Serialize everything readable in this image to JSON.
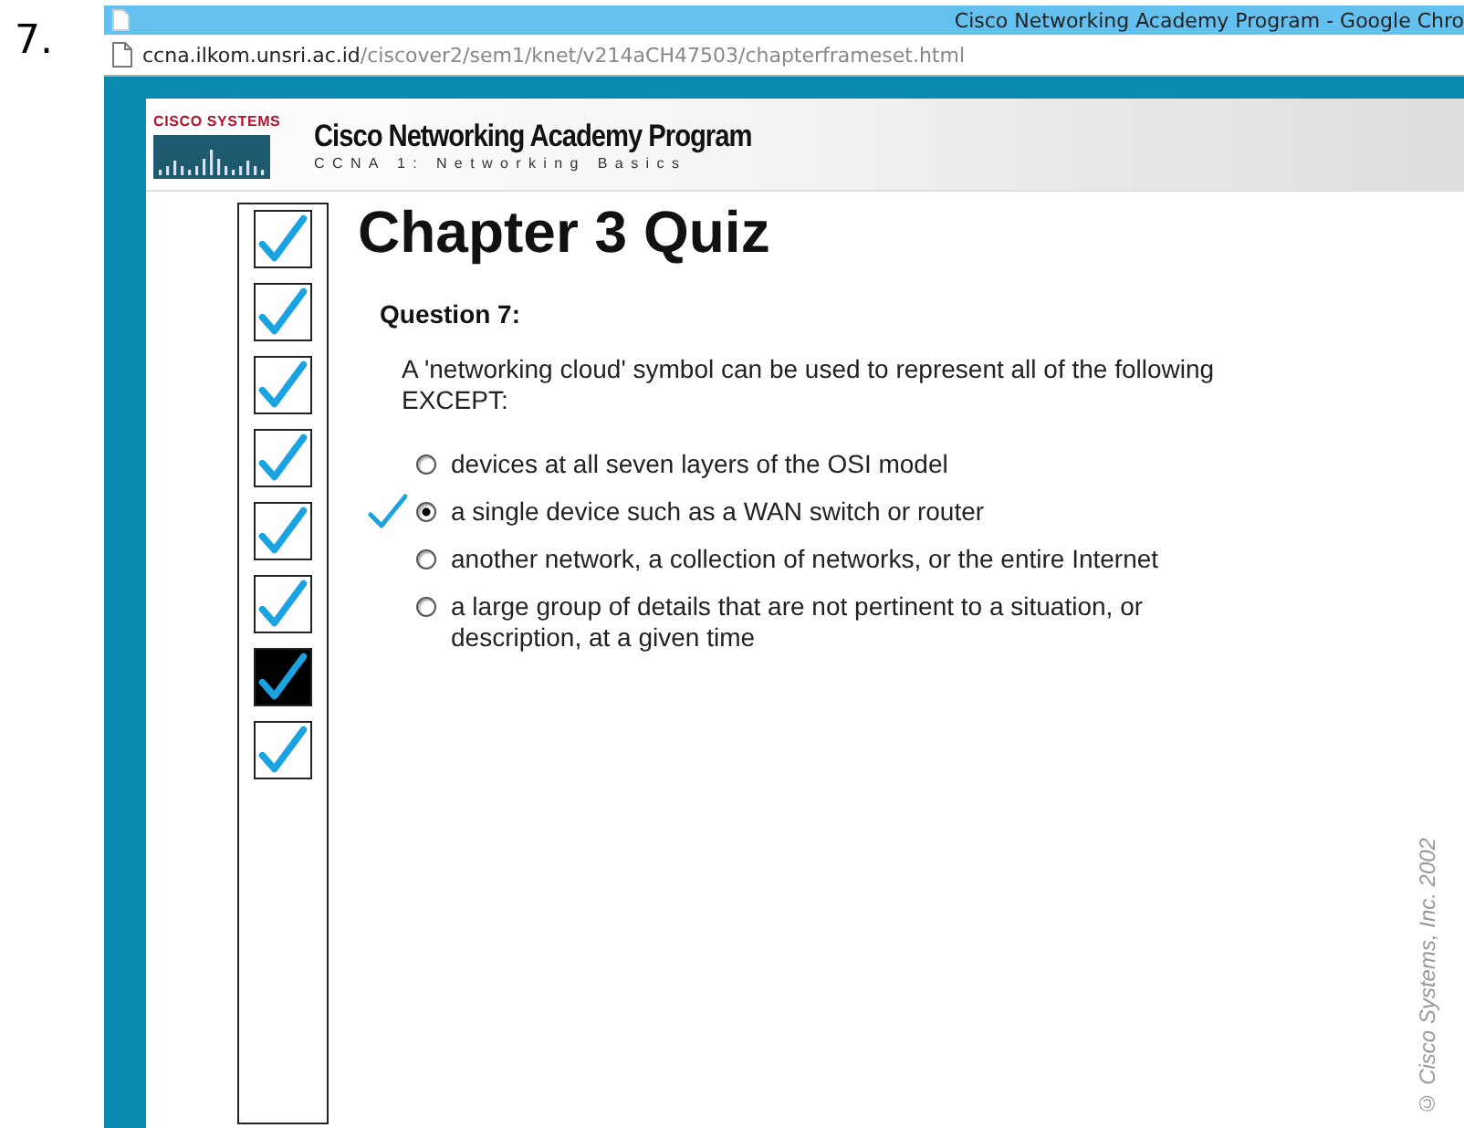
{
  "item_number": "7.",
  "window": {
    "title": "Cisco Networking Academy Program - Google Chro"
  },
  "address_bar": {
    "host": "ccna.ilkom.unsri.ac.id",
    "path": "/ciscover2/sem1/knet/v214aCH47503/chapterframeset.html"
  },
  "header": {
    "logo_text": "CISCO SYSTEMS",
    "title": "Cisco Networking Academy Program",
    "subtitle": "CCNA 1: Networking Basics"
  },
  "progress": [
    {
      "checked": true,
      "selected": false
    },
    {
      "checked": true,
      "selected": false
    },
    {
      "checked": true,
      "selected": false
    },
    {
      "checked": true,
      "selected": false
    },
    {
      "checked": true,
      "selected": false
    },
    {
      "checked": true,
      "selected": false
    },
    {
      "checked": true,
      "selected": true
    },
    {
      "checked": true,
      "selected": false
    }
  ],
  "quiz": {
    "title": "Chapter 3 Quiz",
    "question_label": "Question 7:",
    "question": "A 'networking cloud' symbol can be used to represent all of the following EXCEPT:",
    "options": [
      {
        "text": "devices at all seven layers of the OSI model",
        "selected": false,
        "marked": false
      },
      {
        "text": "a single device such as a WAN switch or router",
        "selected": true,
        "marked": true
      },
      {
        "text": "another network, a collection of networks, or the entire Internet",
        "selected": false,
        "marked": false
      },
      {
        "text": "a large group of details that are not pertinent to a situation, or description, at a given time",
        "selected": false,
        "marked": false
      }
    ]
  },
  "copyright": "© Cisco Systems, Inc. 2002"
}
